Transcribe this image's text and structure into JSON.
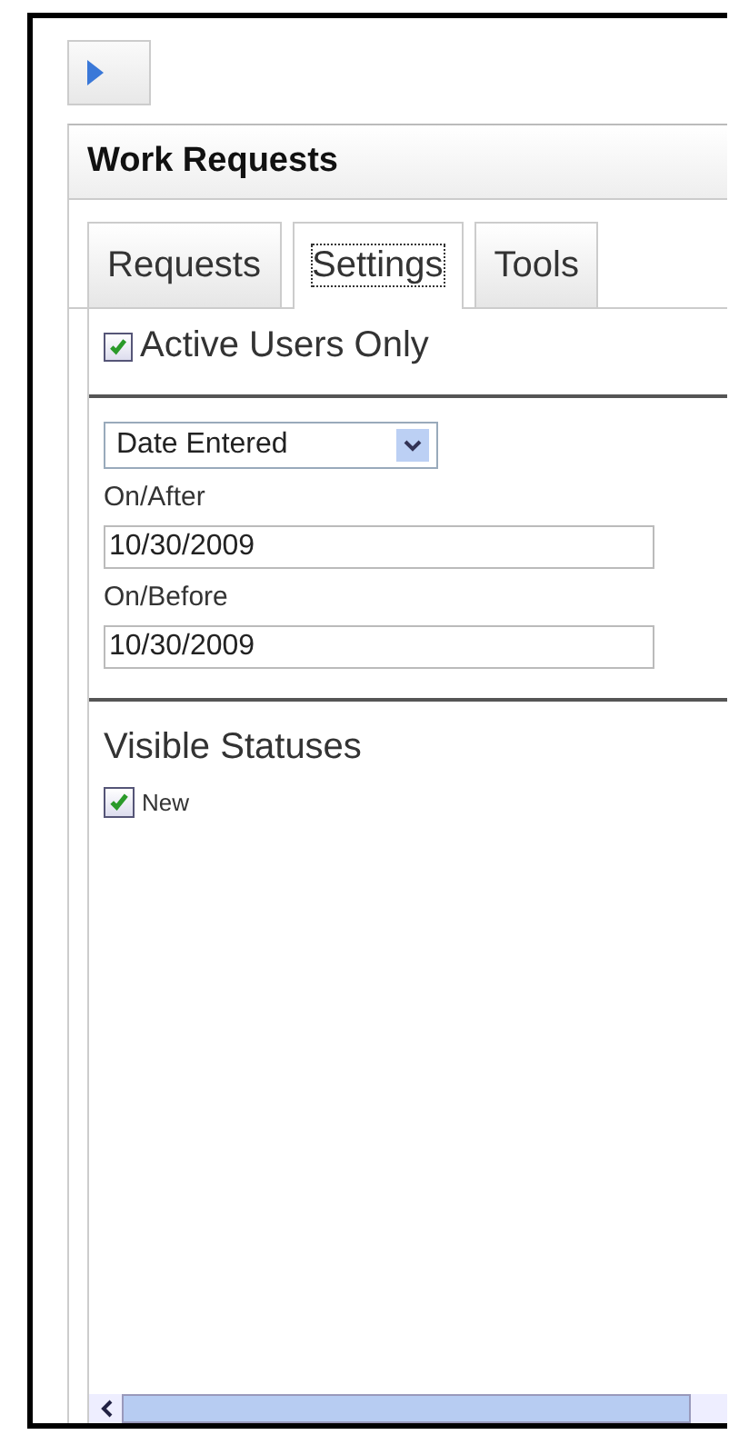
{
  "panel": {
    "title": "Work Requests"
  },
  "tabs": [
    {
      "label": "Requests",
      "selected": false
    },
    {
      "label": "Settings",
      "selected": true
    },
    {
      "label": "Tools",
      "selected": false
    }
  ],
  "active_users": {
    "label": "Active Users Only",
    "checked": true
  },
  "date_filter": {
    "value": "Date Entered"
  },
  "fields": [
    {
      "label": "On/After",
      "value": "10/30/2009"
    },
    {
      "label": "On/Before",
      "value": "10/30/2009"
    }
  ],
  "statuses": {
    "title": "Visible Statuses",
    "items": [
      {
        "label": "New",
        "checked": true
      }
    ]
  }
}
